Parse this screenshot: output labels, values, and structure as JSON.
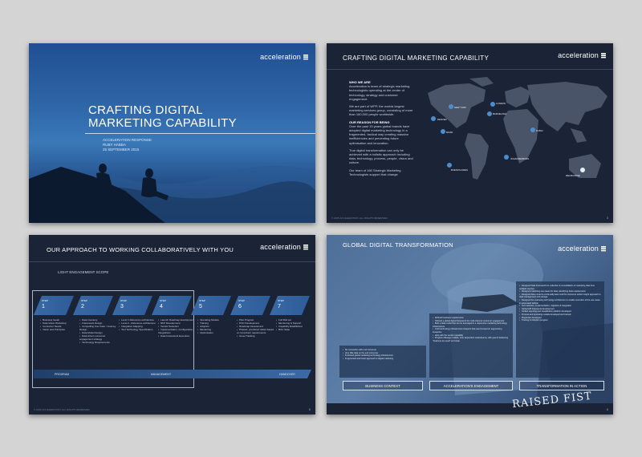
{
  "brand": {
    "name": "acceleration"
  },
  "slide1": {
    "title": [
      "CRAFTING DIGITAL",
      "MARKETING CAPABILITY"
    ],
    "subtitle": [
      "ACCELERATION RESPONSE",
      "RUBY HABBA",
      "25 SEPTEMBER 2015"
    ]
  },
  "slide2": {
    "title": "CRAFTING DIGITAL MARKETING CAPABILITY",
    "who_heading": "WHO WE ARE",
    "who_text": "Acceleration is team of strategic marketing technologists operating at the center of technology, strategy and customer engagement.",
    "wpp_text": "We are part of WPP, the worlds largest marketing services group, consisting of more than 160,000 people worldwide.",
    "reason_heading": "OUR REASON FOR BEING",
    "reason_text": "Over the past 15 years global brands have adopted digital marketing technology in a fragmented, tactical way creating massive inefficiencies and preventing future optimisation and innovation.",
    "transform_text": "True digital transformation can only be achieved with a holistic approach including data, technology, process, people, vision and culture.",
    "team_text": "Our team of 160 Strategic Marketing Technologists support that change",
    "cities": [
      "DENVER",
      "NEW YORK",
      "LONDON",
      "BARCELONA",
      "MIAMI",
      "DUBAI",
      "BUENOS AIRES",
      "JOHANNESBURG",
      "MELBOURNE"
    ],
    "copyright": "© 2015 ACCELERATION. ALL RIGHTS RESERVED.",
    "page": "3"
  },
  "slide3": {
    "title": "OUR APPROACH TO WORKING COLLABORATIVELY WITH YOU",
    "scope": "LIGHT ENGAGEMENT SCOPE",
    "step_label": "STEP",
    "steps": [
      {
        "num": "1",
        "items": [
          "Business Goals",
          "Data Vision Workshop",
          "Consumer Needs",
          "Vision and Principles"
        ]
      },
      {
        "num": "2",
        "items": [
          "Data inventory",
          "Framework Design",
          "Compelling Use Case / Journey Design",
          "Data Model Design",
          "Data driven consumer engagement strategy",
          "Technology Requirements"
        ]
      },
      {
        "num": "3",
        "items": [
          "Level 1 Reference architecture",
          "Level 2 - Reference architecture",
          "Integration Mapping",
          "Tool Technology Specification"
        ]
      },
      {
        "num": "4",
        "items": [
          "Launch Roadmap development",
          "RFP Development",
          "Vendor Selection",
          "Implementation, Configuration, Integrations",
          "Data Framework Execution"
        ]
      },
      {
        "num": "5",
        "items": [
          "Operating Models",
          "Training",
          "Adoption",
          "Monitoring",
          "Optimisation"
        ]
      },
      {
        "num": "6",
        "items": [
          "Pilot Program",
          "POC Development",
          "Roadmap Assessment",
          "Phased, prioritized rollout based on incumbent requirements",
          "Issue Tracking"
        ]
      },
      {
        "num": "7",
        "items": [
          "Full Roll out",
          "Monitoring & Support",
          "Capability Established",
          "BAU State"
        ]
      }
    ],
    "bar": [
      "PROGRAM",
      "MANAGEMENT",
      "HANDOVER"
    ],
    "copyright": "© 2015 ACCELERATION. ALL RIGHTS RESERVED.",
    "page": "6"
  },
  "slide4": {
    "title": "GLOBAL DIGITAL TRANSFORMATION",
    "context_items": [
      "No connection with end consumer",
      "Very little data on the end consumer",
      "Fractured global marketing technology infrastructure",
      "Fragmented and linear approach to digital marketing"
    ],
    "engagement_items": [
      "Defined business requirements",
      "Tailored a global digital framework for multi-channel consumer engagement",
      "Built a data model that can be leveraged in a responsive marketing technology infrastructure",
      "Craft technology infrastructure blueprint that was focused on augmenting Fresenius",
      "Help with the vendor capability",
      "Program Manage multiple, inter-dependent workstreams, with goal of delivering \"business as usual\" end state"
    ],
    "action_items": [
      "Designed Data Framework for collection & consolidation of marketing data from multiple sources",
      "Designed marketing use cases for data, identifying data requirements",
      "Designed data model to continually learn and the consumer action insight approach to data management and storage",
      "Designed the marketing technology architecture to enable execution of the use cases in automated fashion",
      "Tool selection, implementation, migration & integration",
      "Global API framework development",
      "Unified reporting and visualization platform developed",
      "Process and operating models developed and trained",
      "Playbooks developed",
      "Training & Adoption program"
    ],
    "footers": [
      "BUSINESS CONTEXT",
      "ACCELERATION'S ENGAGEMENT",
      "TRANSFORMATION IN ACTION"
    ],
    "sign_text": "RAISED FIST",
    "page": "8"
  }
}
